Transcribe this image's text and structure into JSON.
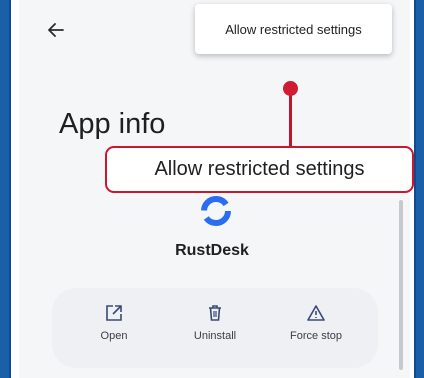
{
  "menu": {
    "item_label": "Allow restricted settings"
  },
  "page": {
    "title": "App info"
  },
  "app": {
    "name": "RustDesk",
    "icon": "rustdesk-logo"
  },
  "actions": [
    {
      "label": "Open",
      "icon": "open-external-icon"
    },
    {
      "label": "Uninstall",
      "icon": "trash-icon"
    },
    {
      "label": "Force stop",
      "icon": "warning-icon"
    }
  ],
  "callout": {
    "label": "Allow restricted settings",
    "color": "#c9172f"
  },
  "colors": {
    "accent": "#1a5fa8",
    "app_blue": "#2a6df0"
  }
}
